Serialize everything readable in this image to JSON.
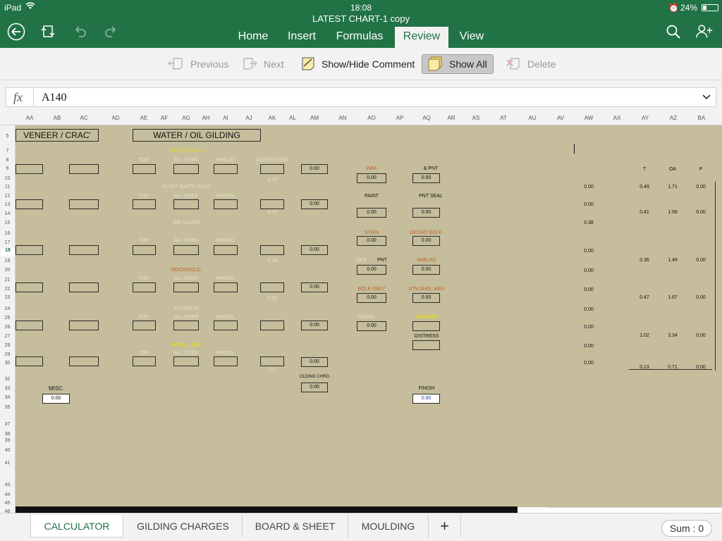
{
  "status_bar": {
    "device": "iPad",
    "time": "18:08",
    "battery": "24%"
  },
  "window": {
    "title": "LATEST CHART-1 copy"
  },
  "toolbar_icons": [
    "back-icon",
    "sync-icon",
    "undo-icon",
    "redo-icon",
    "search-icon",
    "add-person-icon"
  ],
  "ribbon_tabs": [
    {
      "label": "Home"
    },
    {
      "label": "Insert"
    },
    {
      "label": "Formulas"
    },
    {
      "label": "Review"
    },
    {
      "label": "View"
    }
  ],
  "active_tab": "Review",
  "review_commands": {
    "previous": "Previous",
    "next": "Next",
    "show_hide": "Show/Hide Comment",
    "show_all": "Show All",
    "delete": "Delete"
  },
  "formula_bar": {
    "fx": "fx",
    "value": "A140"
  },
  "columns": [
    "AA",
    "AB",
    "AC",
    "AD",
    "AE",
    "AF",
    "AG",
    "AH",
    "AI",
    "AJ",
    "AK",
    "AL",
    "AM",
    "AN",
    "AO",
    "AP",
    "AQ",
    "AR",
    "AS",
    "AT",
    "AU",
    "AV",
    "AW",
    "AX",
    "AY",
    "AZ",
    "BA"
  ],
  "rows": [
    "5",
    "7",
    "8",
    "9",
    "10",
    "11",
    "12",
    "13",
    "14",
    "15",
    "16",
    "17",
    "18",
    "19",
    "20",
    "21",
    "22",
    "23",
    "24",
    "25",
    "26",
    "27",
    "28",
    "29",
    "30",
    "32",
    "33",
    "34",
    "35",
    "37",
    "38",
    "39",
    "40",
    "41",
    "43",
    "44",
    "45",
    "46"
  ],
  "active_row": "18",
  "sheet": {
    "headers": {
      "veneer": "VENEER / CRAC'",
      "water": "WATER / OIL GILDING"
    },
    "gilding_labels": {
      "gold_23": "23.5 CT GOLD",
      "white_gold": "12.5CT  WHITE GOLD",
      "silver": "999 SILVER",
      "moongold": "MOONGOLD",
      "platinum": "PLATINUM",
      "metal_leaf": "METAL LEAF",
      "top": "TOP",
      "all_over": "ALL OVER",
      "parcel": "PARCEL",
      "distressing": "DISTRESSING"
    },
    "faint_values": [
      "0.10",
      "0.14",
      "0.18",
      "0.30",
      "0.1"
    ],
    "row_totals": [
      "0.00",
      "0.00",
      "0.00",
      "0.00",
      "0.00",
      "0.00"
    ],
    "finish_labels": {
      "wax": "WAX",
      "pnt": "& PNT",
      "paint": "PAINT",
      "pnt_seal": "PNT SEAL",
      "stain": "STAIN",
      "gesso_bole": "GESSO BOLE",
      "gesso_pnt_a": "GES",
      "gesso_pnt_b": "PNT",
      "shelac": "SHELAC",
      "bole_only": "BOLE ONLY",
      "stn_shel_wax": "STN SHEL WAX",
      "gesso": "GESSO",
      "burnish": "BURNISH",
      "distress": "DISTRESS"
    },
    "finish_values": [
      "0.00",
      "0.00",
      "0.00",
      "0.00",
      "0.00",
      "0.00",
      "0.00",
      "0.00",
      "0.00",
      "0.00",
      "0.00"
    ],
    "misc": {
      "label": "MISC",
      "value": "0.00"
    },
    "gilding_chrg": {
      "label": "GLDING CHRG",
      "value": "0.00"
    },
    "finish": {
      "label": "FINISH",
      "value": "0.00"
    },
    "right_headers": {
      "t": "T",
      "oa": "OA",
      "p": "P"
    },
    "aw_values": [
      "0.00",
      "0.00",
      "0.38",
      "0.00",
      "0.00",
      "0.00",
      "0.00",
      "0.00",
      "0.00",
      "0.00",
      "0.00"
    ],
    "ay_rows": [
      {
        "t": "0.49",
        "oa": "1.71",
        "p": "0.00"
      },
      {
        "t": "0.41",
        "oa": "1.56",
        "p": "0.00"
      },
      {
        "t": "0.36",
        "oa": "1.49",
        "p": "0.00"
      },
      {
        "t": "0.47",
        "oa": "1.67",
        "p": "0.00"
      },
      {
        "t": "1.02",
        "oa": "3.34",
        "p": "0.00"
      },
      {
        "t": "0.13",
        "oa": "0.71",
        "p": "0.00"
      }
    ]
  },
  "sheet_tabs": [
    {
      "label": "CALCULATOR"
    },
    {
      "label": "GILDING CHARGES"
    },
    {
      "label": "BOARD & SHEET"
    },
    {
      "label": "MOULDING"
    }
  ],
  "active_sheet": "CALCULATOR",
  "add_sheet": "+",
  "sum": {
    "label": "Sum : 0"
  },
  "colors": {
    "excel_green": "#217346",
    "sheet_fill": "#c5bd9b",
    "orange_text": "#c0622a",
    "yellow_text": "#f2e100"
  }
}
